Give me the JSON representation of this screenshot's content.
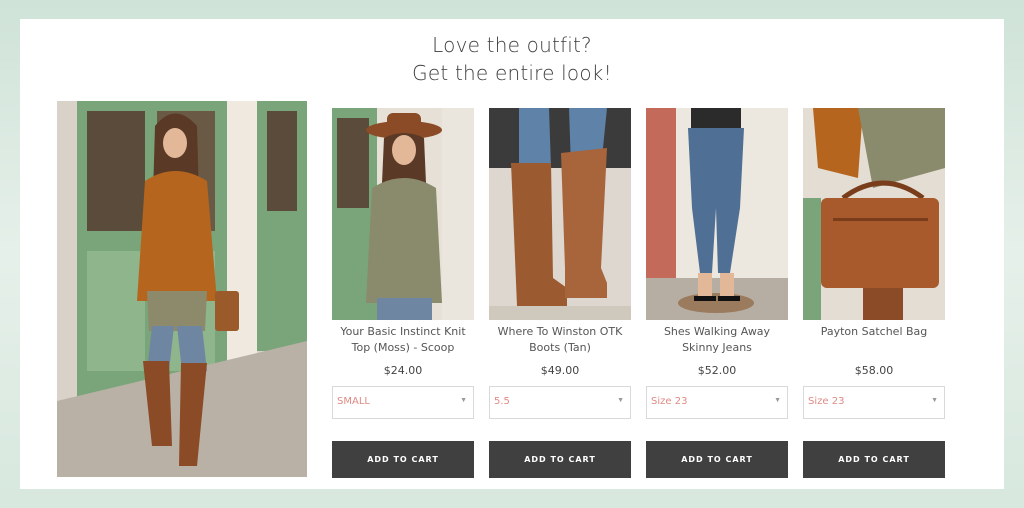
{
  "heading": {
    "line1": "Love the outfit?",
    "line2": "Get the entire look!"
  },
  "hero": {
    "icon": "outfit-hero-photo"
  },
  "products": [
    {
      "name": "Your Basic Instinct Knit Top (Moss) - Scoop",
      "price": "$24.00",
      "option": "SMALL",
      "cta": "ADD TO CART"
    },
    {
      "name": "Where To Winston OTK Boots (Tan)",
      "price": "$49.00",
      "option": "5.5",
      "cta": "ADD TO CART"
    },
    {
      "name": "Shes Walking Away Skinny Jeans",
      "price": "$52.00",
      "option": "Size 23",
      "cta": "ADD TO CART"
    },
    {
      "name": "Payton Satchel Bag",
      "price": "$58.00",
      "option": "Size 23",
      "cta": "ADD TO CART"
    }
  ],
  "colors": {
    "button_bg": "#404040",
    "option_text": "#e08a85",
    "page_bg": "#d7e8de"
  }
}
